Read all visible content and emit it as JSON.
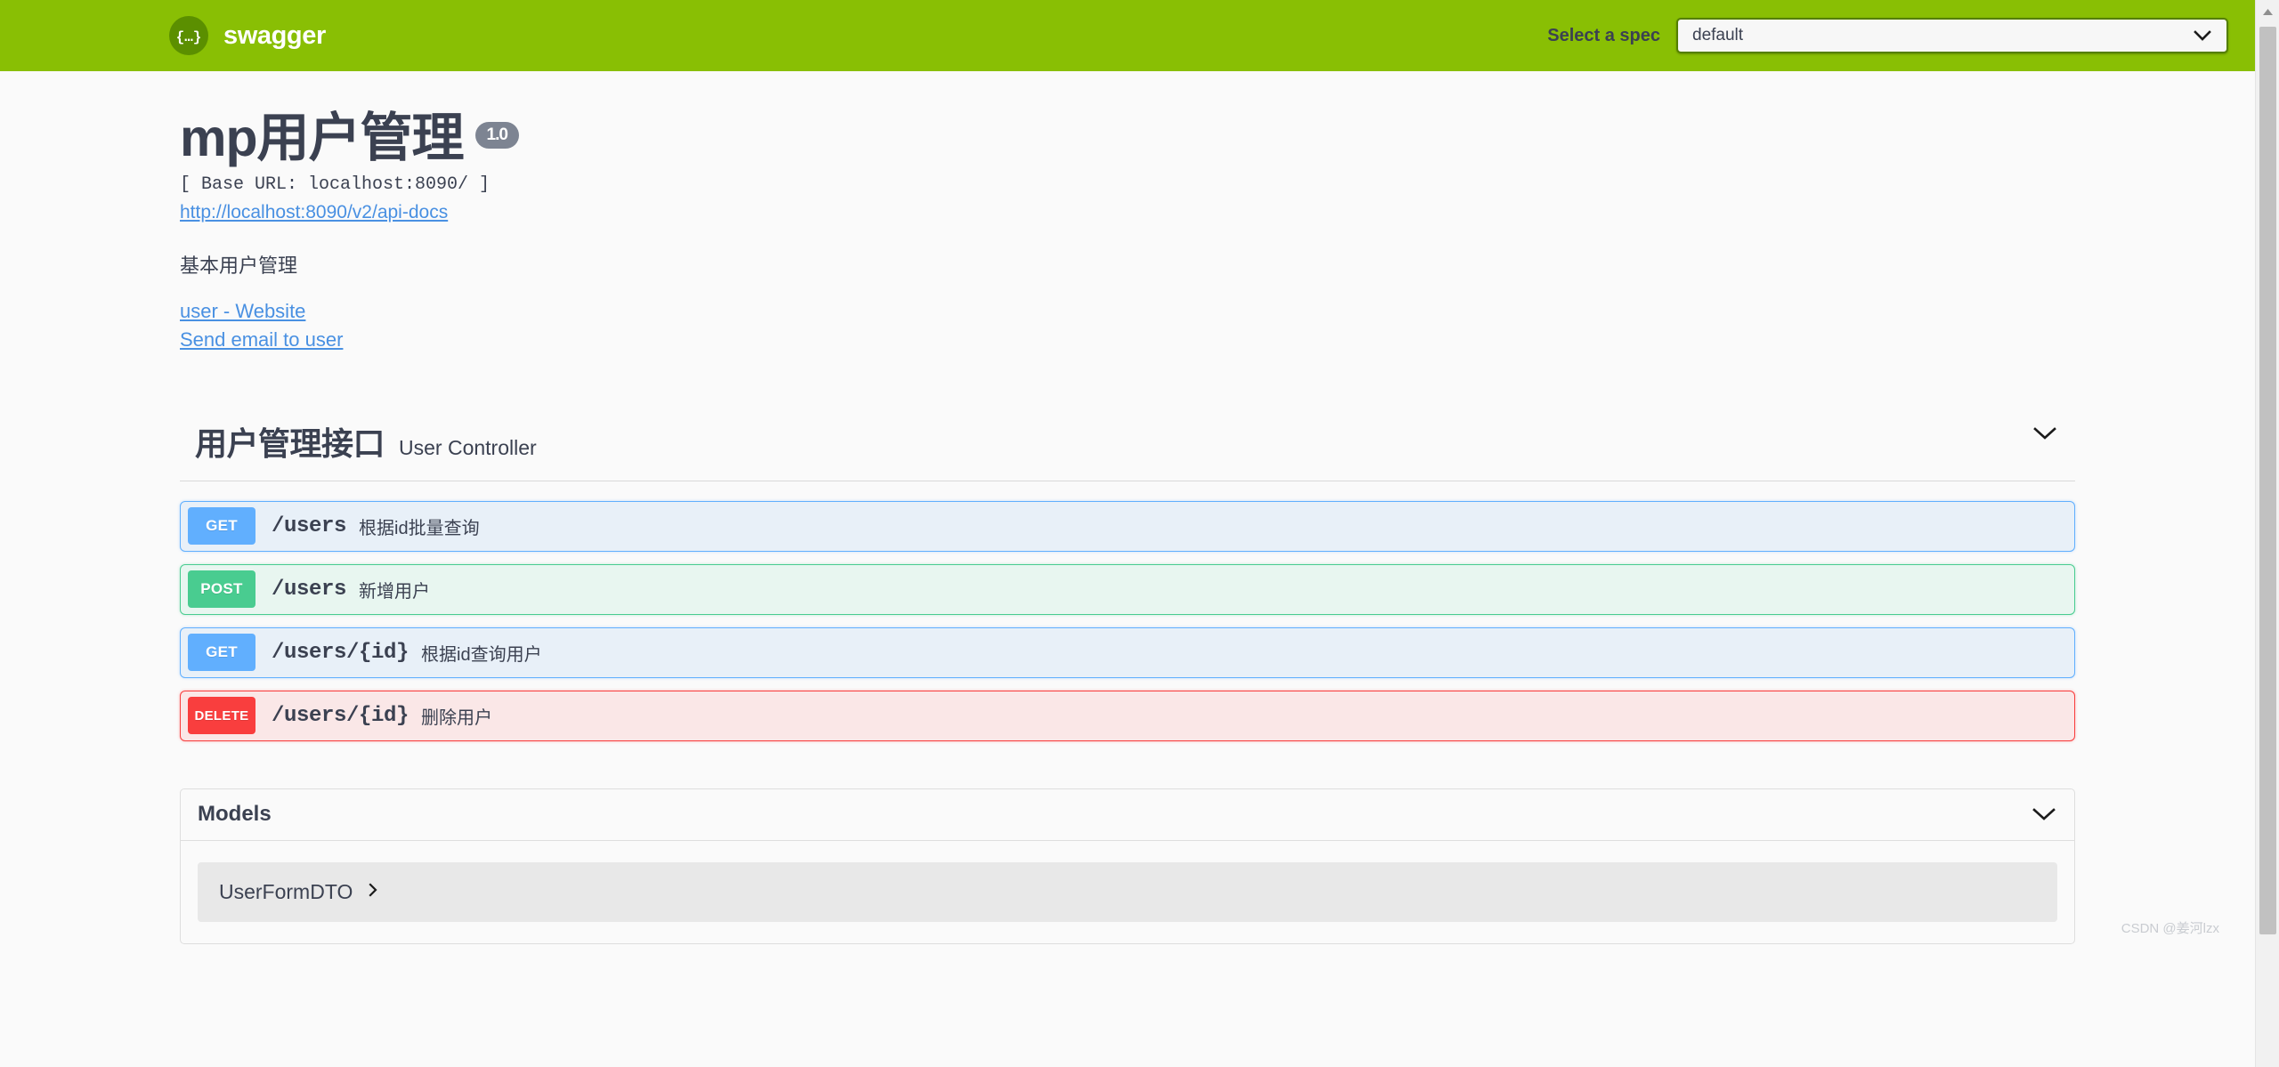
{
  "topbar": {
    "logo_text": "swagger",
    "logo_icon": "swagger-braces-icon",
    "spec_label": "Select a spec",
    "spec_selected": "default",
    "spec_options": [
      "default"
    ],
    "caret_icon": "chevron-down-icon",
    "bg_color": "#89bf04"
  },
  "info": {
    "title": "mp用户管理",
    "version": "1.0",
    "base_url": "[ Base URL: localhost:8090/ ]",
    "docs_url": "http://localhost:8090/v2/api-docs",
    "description": "基本用户管理",
    "contact_website": "user - Website",
    "contact_email": "Send email to user"
  },
  "tag_section": {
    "name": "用户管理接口",
    "description": "User Controller",
    "chevron_icon": "chevron-down-icon",
    "operations": [
      {
        "method": "GET",
        "path": "/users",
        "summary": "根据id批量查询",
        "color": "#61affe"
      },
      {
        "method": "POST",
        "path": "/users",
        "summary": "新增用户",
        "color": "#49cc90"
      },
      {
        "method": "GET",
        "path": "/users/{id}",
        "summary": "根据id查询用户",
        "color": "#61affe"
      },
      {
        "method": "DELETE",
        "path": "/users/{id}",
        "summary": "删除用户",
        "color": "#f93e3e"
      }
    ]
  },
  "models": {
    "title": "Models",
    "chevron_icon": "chevron-down-icon",
    "items": [
      {
        "name": "UserFormDTO",
        "expand_icon": "chevron-right-icon"
      }
    ]
  },
  "scrollbar": {
    "up_arrow_icon": "triangle-up-icon"
  },
  "watermark": {
    "text": "CSDN @姜河lzx"
  }
}
